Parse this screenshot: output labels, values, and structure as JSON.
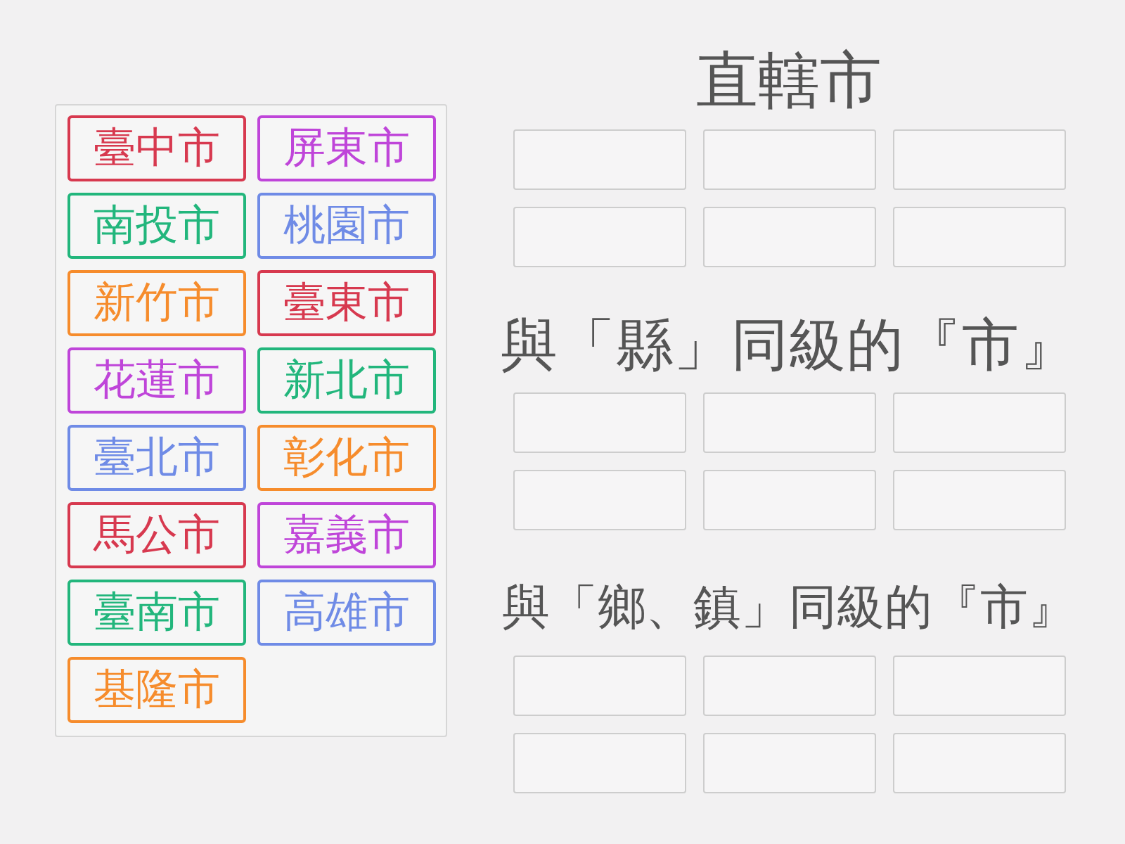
{
  "tiles": [
    {
      "label": "臺中市",
      "color": "#d7394f"
    },
    {
      "label": "屏東市",
      "color": "#bf45d9"
    },
    {
      "label": "南投市",
      "color": "#22b67c"
    },
    {
      "label": "桃園市",
      "color": "#6f8be6"
    },
    {
      "label": "新竹市",
      "color": "#f68c2c"
    },
    {
      "label": "臺東市",
      "color": "#d7394f"
    },
    {
      "label": "花蓮市",
      "color": "#bf45d9"
    },
    {
      "label": "新北市",
      "color": "#22b67c"
    },
    {
      "label": "臺北市",
      "color": "#6f8be6"
    },
    {
      "label": "彰化市",
      "color": "#f68c2c"
    },
    {
      "label": "馬公市",
      "color": "#d7394f"
    },
    {
      "label": "嘉義市",
      "color": "#bf45d9"
    },
    {
      "label": "臺南市",
      "color": "#22b67c"
    },
    {
      "label": "高雄市",
      "color": "#6f8be6"
    },
    {
      "label": "基隆市",
      "color": "#f68c2c"
    }
  ],
  "categories": [
    {
      "heading": "直轄市"
    },
    {
      "heading": "與「縣」同級的『市』"
    },
    {
      "heading": "與「鄉、鎮」同級的『市』"
    }
  ]
}
